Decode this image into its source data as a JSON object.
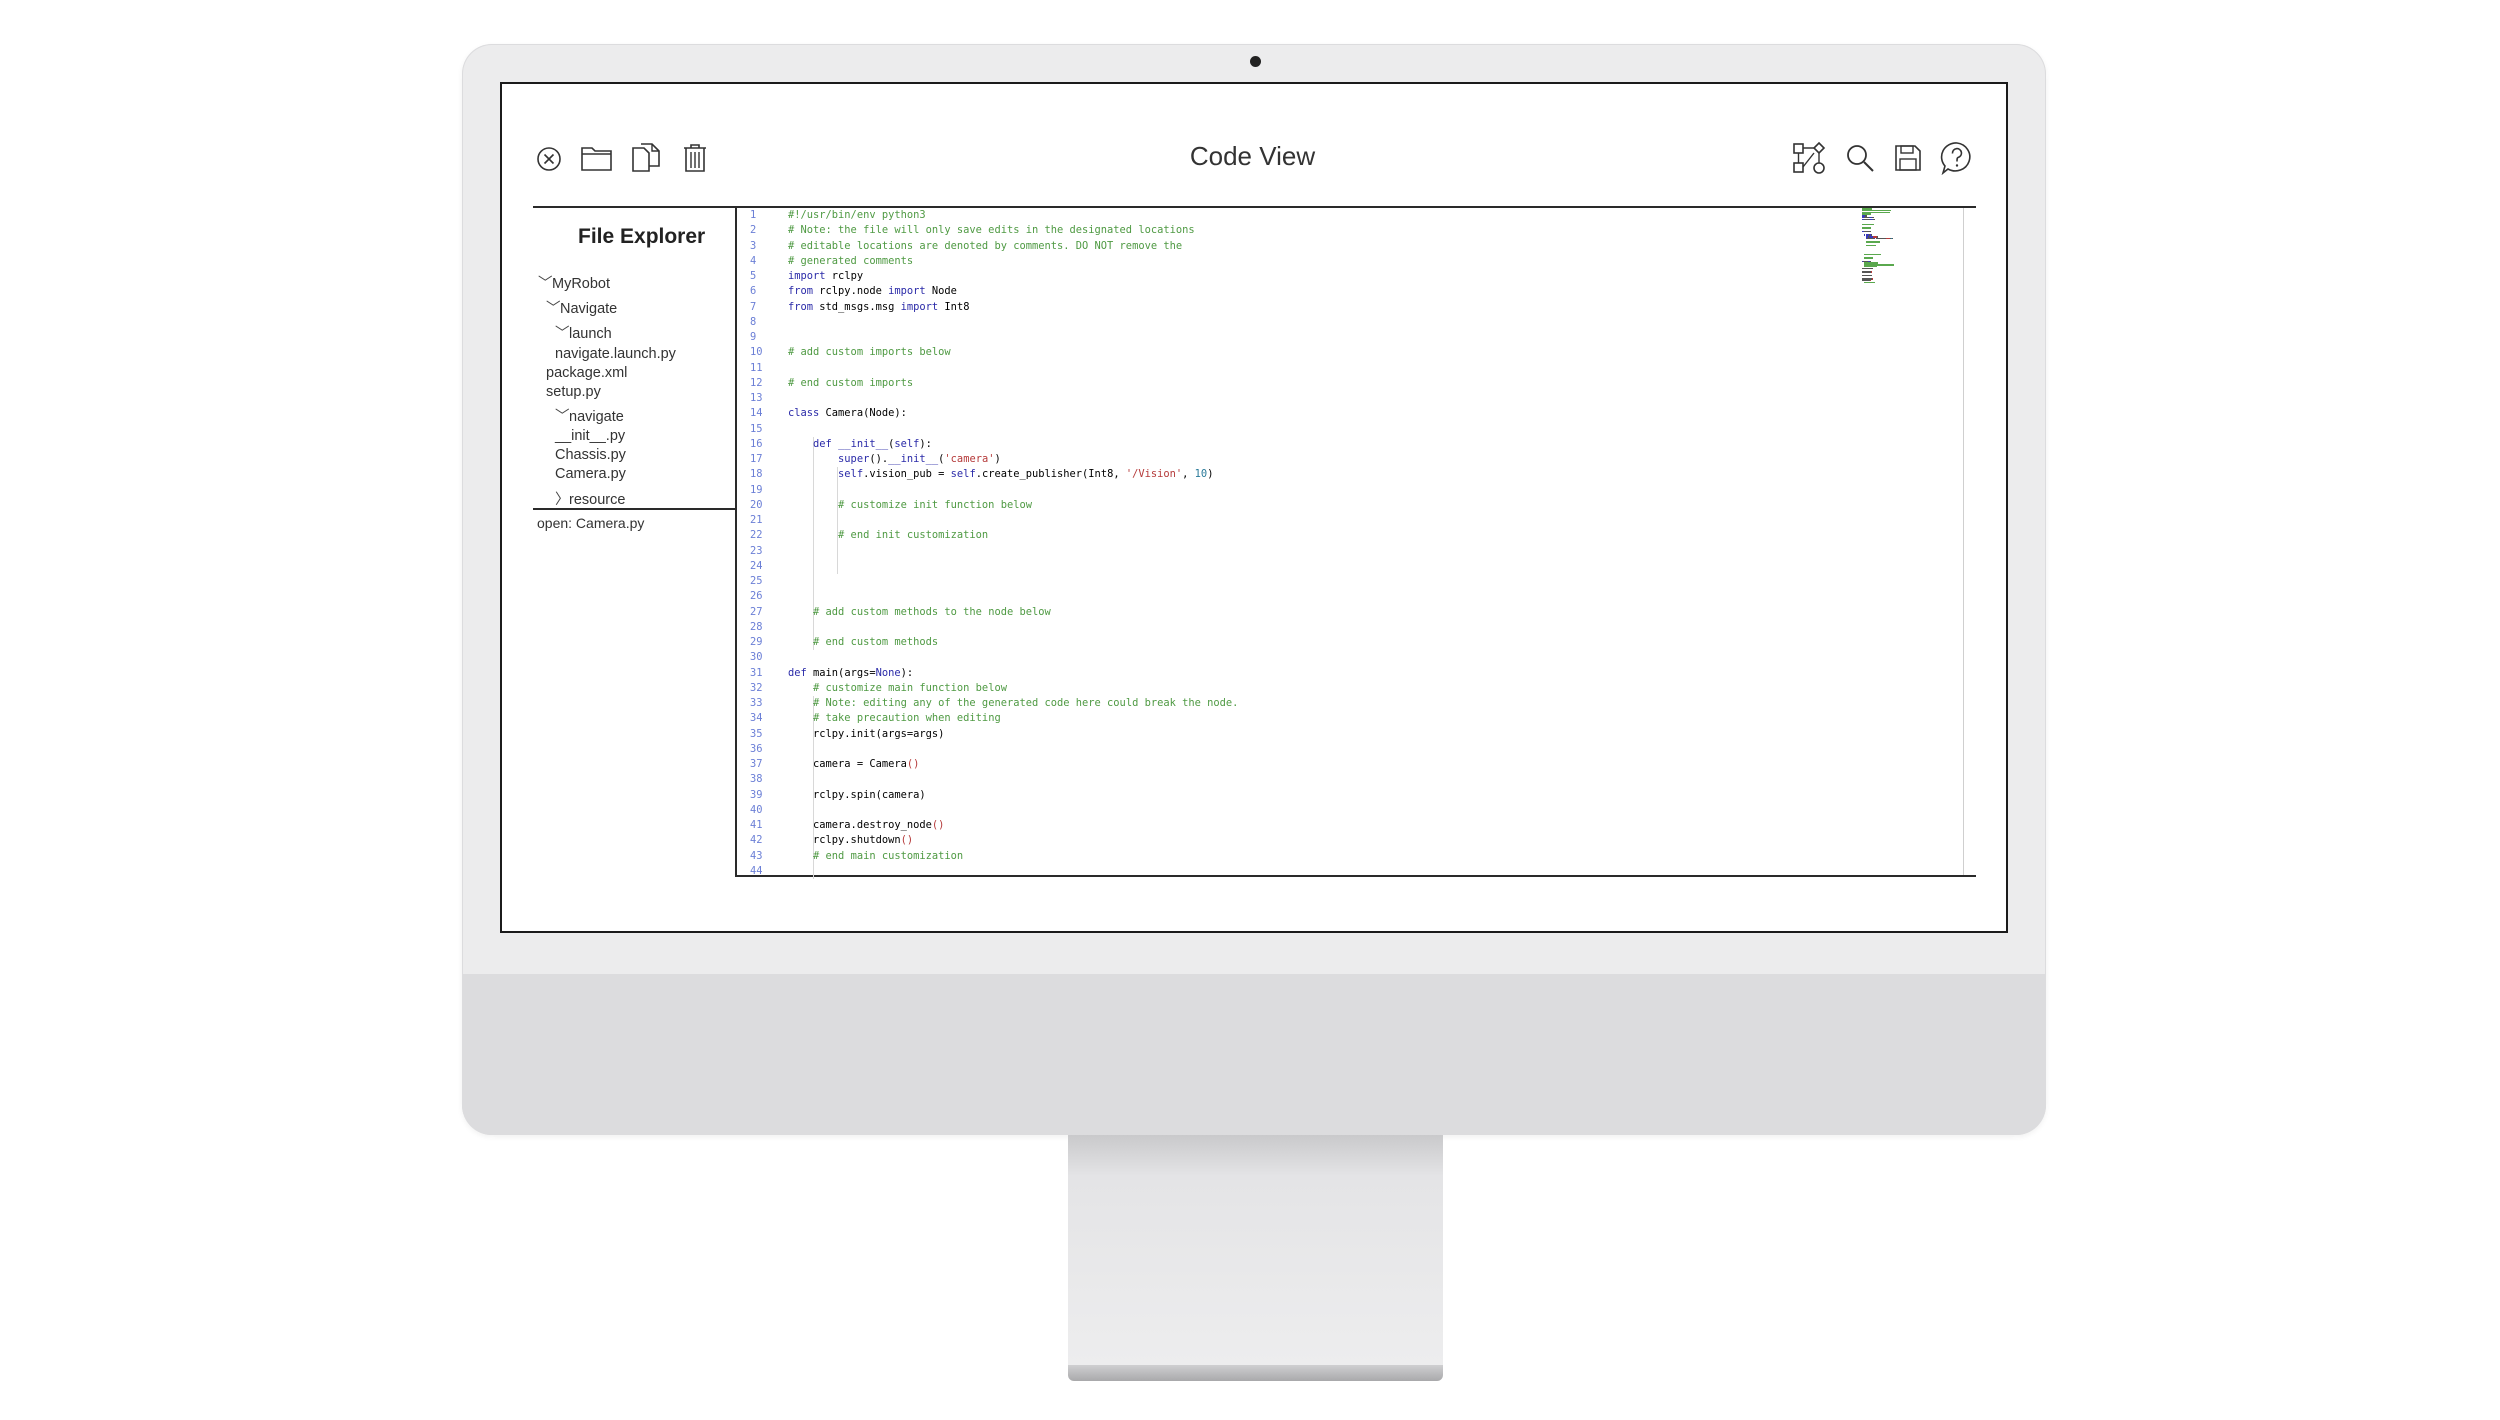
{
  "toolbar": {
    "title": "Code View",
    "left_icons": [
      "close-icon",
      "open-folder-icon",
      "copy-file-icon",
      "trash-icon"
    ],
    "right_icons": [
      "flow-diagram-icon",
      "search-icon",
      "save-icon",
      "help-icon"
    ]
  },
  "explorer": {
    "title": "File Explorer",
    "tree": [
      {
        "label": "MyRobot",
        "chevron": "﹀"
      },
      {
        "label": "Navigate",
        "chevron": "﹀"
      },
      {
        "label": "launch",
        "chevron": "﹀"
      },
      {
        "label": "navigate.launch.py",
        "chevron": ""
      },
      {
        "label": "package.xml",
        "chevron": ""
      },
      {
        "label": "setup.py",
        "chevron": ""
      },
      {
        "label": "navigate",
        "chevron": "﹀"
      },
      {
        "label": "__init__.py",
        "chevron": ""
      },
      {
        "label": "Chassis.py",
        "chevron": ""
      },
      {
        "label": "Camera.py",
        "chevron": ""
      },
      {
        "label": "resource",
        "chevron": "〉"
      }
    ],
    "open_status": "open: Camera.py"
  },
  "editor": {
    "lines": [
      [
        {
          "t": "#!/usr/bin/env python3",
          "c": "com"
        }
      ],
      [
        {
          "t": "# Note: the file will only save edits in the designated locations",
          "c": "com"
        }
      ],
      [
        {
          "t": "# editable locations are denoted by comments. DO NOT remove the",
          "c": "com"
        }
      ],
      [
        {
          "t": "# generated comments",
          "c": "com"
        }
      ],
      [
        {
          "t": "import",
          "c": "kw"
        },
        {
          "t": " rclpy",
          "c": ""
        }
      ],
      [
        {
          "t": "from",
          "c": "kw"
        },
        {
          "t": " rclpy.node ",
          "c": ""
        },
        {
          "t": "import",
          "c": "kw"
        },
        {
          "t": " Node",
          "c": ""
        }
      ],
      [
        {
          "t": "from",
          "c": "kw"
        },
        {
          "t": " std_msgs.msg ",
          "c": ""
        },
        {
          "t": "import",
          "c": "kw"
        },
        {
          "t": " Int8",
          "c": ""
        }
      ],
      [],
      [],
      [
        {
          "t": "# add custom imports below",
          "c": "com"
        }
      ],
      [],
      [
        {
          "t": "# end custom imports",
          "c": "com"
        }
      ],
      [],
      [
        {
          "t": "class",
          "c": "kw"
        },
        {
          "t": " Camera(Node):",
          "c": ""
        }
      ],
      [],
      [
        {
          "t": "    ",
          "c": ""
        },
        {
          "t": "def",
          "c": "kw"
        },
        {
          "t": " ",
          "c": ""
        },
        {
          "t": "__init__",
          "c": "fn"
        },
        {
          "t": "(",
          "c": ""
        },
        {
          "t": "self",
          "c": "self"
        },
        {
          "t": "):",
          "c": ""
        }
      ],
      [
        {
          "t": "        ",
          "c": ""
        },
        {
          "t": "super",
          "c": "fn"
        },
        {
          "t": "().",
          "c": ""
        },
        {
          "t": "__init__",
          "c": "fn"
        },
        {
          "t": "(",
          "c": ""
        },
        {
          "t": "'camera'",
          "c": "str"
        },
        {
          "t": ")",
          "c": ""
        }
      ],
      [
        {
          "t": "        ",
          "c": ""
        },
        {
          "t": "self",
          "c": "self"
        },
        {
          "t": ".vision_pub = ",
          "c": ""
        },
        {
          "t": "self",
          "c": "self"
        },
        {
          "t": ".create_publisher(Int8, ",
          "c": ""
        },
        {
          "t": "'/Vision'",
          "c": "str"
        },
        {
          "t": ", ",
          "c": ""
        },
        {
          "t": "10",
          "c": "num"
        },
        {
          "t": ")",
          "c": ""
        }
      ],
      [],
      [
        {
          "t": "        ",
          "c": ""
        },
        {
          "t": "# customize init function below",
          "c": "com"
        }
      ],
      [],
      [
        {
          "t": "        ",
          "c": ""
        },
        {
          "t": "# end init customization",
          "c": "com"
        }
      ],
      [],
      [],
      [],
      [],
      [
        {
          "t": "    ",
          "c": ""
        },
        {
          "t": "# add custom methods to the node below",
          "c": "com"
        }
      ],
      [],
      [
        {
          "t": "    ",
          "c": ""
        },
        {
          "t": "# end custom methods",
          "c": "com"
        }
      ],
      [],
      [
        {
          "t": "def",
          "c": "kw"
        },
        {
          "t": " main(args=",
          "c": ""
        },
        {
          "t": "None",
          "c": "kw"
        },
        {
          "t": "):",
          "c": ""
        }
      ],
      [
        {
          "t": "    ",
          "c": ""
        },
        {
          "t": "# customize main function below",
          "c": "com"
        }
      ],
      [
        {
          "t": "    ",
          "c": ""
        },
        {
          "t": "# Note: editing any of the generated code here could break the node.",
          "c": "com"
        }
      ],
      [
        {
          "t": "    ",
          "c": ""
        },
        {
          "t": "# take precaution when editing",
          "c": "com"
        }
      ],
      [
        {
          "t": "    rclpy.init(args=args)",
          "c": ""
        }
      ],
      [],
      [
        {
          "t": "    camera = Camera",
          "c": ""
        },
        {
          "t": "()",
          "c": "str"
        }
      ],
      [],
      [
        {
          "t": "    rclpy.spin(camera)",
          "c": ""
        }
      ],
      [],
      [
        {
          "t": "    camera.destroy_node",
          "c": ""
        },
        {
          "t": "()",
          "c": "str"
        }
      ],
      [
        {
          "t": "    rclpy.shutdown",
          "c": ""
        },
        {
          "t": "()",
          "c": "str"
        }
      ],
      [
        {
          "t": "    ",
          "c": ""
        },
        {
          "t": "# end main customization",
          "c": "com"
        }
      ],
      []
    ]
  }
}
